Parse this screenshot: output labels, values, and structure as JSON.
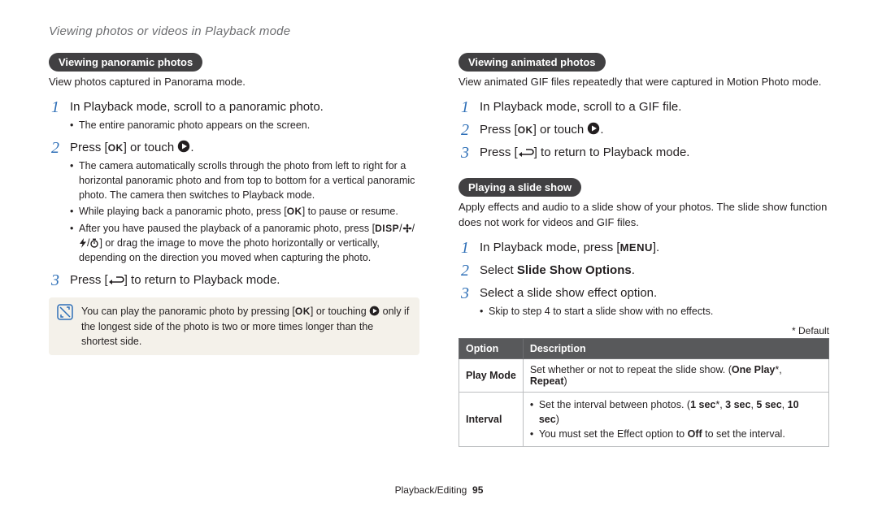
{
  "page_title": "Viewing photos or videos in Playback mode",
  "footer": {
    "section": "Playback/Editing",
    "page": "95"
  },
  "left": {
    "heading": "Viewing panoramic photos",
    "intro": "View photos captured in Panorama mode.",
    "steps": [
      {
        "num": "1",
        "text": "In Playback mode, scroll to a panoramic photo.",
        "bullets": [
          "The entire panoramic photo appears on the screen."
        ]
      },
      {
        "num": "2",
        "text_before": "Press [",
        "text_mid": "] or touch ",
        "text_after": ".",
        "bullets": [
          "The camera automatically scrolls through the photo from left to right for a horizontal panoramic photo and from top to bottom for a vertical panoramic photo. The camera then switches to Playback mode.",
          "While playing back a panoramic photo, press [OK] to pause or resume.",
          "After you have paused the playback of a panoramic photo, press [DISP/⚘/⌕/⏱] or drag the image to move the photo horizontally or vertically, depending on the direction you moved when capturing the photo."
        ]
      },
      {
        "num": "3",
        "text_before": "Press [",
        "text_after": "] to return to Playback mode."
      }
    ],
    "note": "You can play the panoramic photo by pressing [OK] or touching ▶ only if the longest side of the photo is two or more times longer than the shortest side."
  },
  "right": {
    "heading1": "Viewing animated photos",
    "intro1": "View animated GIF files repeatedly that were captured in Motion Photo mode.",
    "steps1": [
      {
        "num": "1",
        "text": "In Playback mode, scroll to a GIF file."
      },
      {
        "num": "2",
        "text_before": "Press [",
        "text_mid": "] or touch ",
        "text_after": "."
      },
      {
        "num": "3",
        "text_before": "Press [",
        "text_after": "] to return to Playback mode."
      }
    ],
    "heading2": "Playing a slide show",
    "intro2": "Apply effects and audio to a slide show of your photos. The slide show function does not work for videos and GIF files.",
    "steps2": [
      {
        "num": "1",
        "text_before": "In Playback mode, press [",
        "text_after": "]."
      },
      {
        "num": "2",
        "text_before": "Select ",
        "bold": "Slide Show Options",
        "text_after": "."
      },
      {
        "num": "3",
        "text": "Select a slide show effect option.",
        "bullets": [
          "Skip to step 4 to start a slide show with no effects."
        ]
      }
    ],
    "default_label": "* Default",
    "table": {
      "head": {
        "c1": "Option",
        "c2": "Description"
      },
      "rows": [
        {
          "opt": "Play Mode",
          "desc_before": "Set whether or not to repeat the slide show. (",
          "desc_bold1": "One Play",
          "desc_mid": "*, ",
          "desc_bold2": "Repeat",
          "desc_after": ")"
        },
        {
          "opt": "Interval",
          "items": [
            {
              "before": "Set the interval between photos. (",
              "b1": "1 sec",
              "mid1": "*, ",
              "b2": "3 sec",
              "mid2": ", ",
              "b3": "5 sec",
              "mid3": ", ",
              "b4": "10 sec",
              "after": ")"
            },
            {
              "before": "You must set the Effect option to ",
              "b1": "Off",
              "after": " to set the interval."
            }
          ]
        }
      ]
    }
  }
}
